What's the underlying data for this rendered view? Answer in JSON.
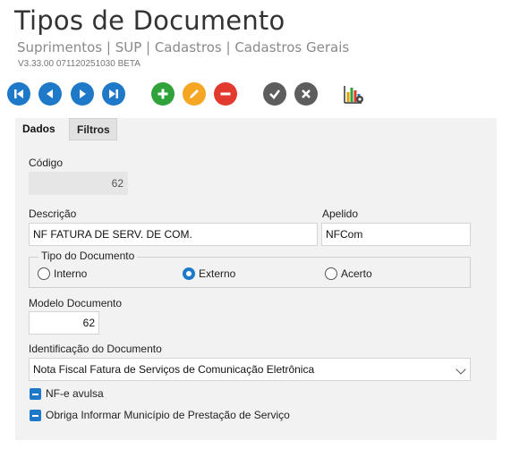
{
  "header": {
    "title": "Tipos de Documento",
    "breadcrumb": "Suprimentos | SUP | Cadastros | Cadastros Gerais",
    "version": "V3.33.00 071120251030 BETA"
  },
  "toolbar": {
    "icons": [
      "first-record-icon",
      "previous-record-icon",
      "next-record-icon",
      "last-record-icon",
      "add-icon",
      "edit-icon",
      "delete-icon",
      "confirm-icon",
      "cancel-icon",
      "chart-settings-icon"
    ],
    "colors": {
      "nav": "#1f79c9",
      "add": "#2fa33a",
      "edit": "#f5a623",
      "delete": "#e23a2e",
      "confirm": "#5d5d5d"
    }
  },
  "tabs": [
    "Dados",
    "Filtros"
  ],
  "form": {
    "codigo_label": "Código",
    "codigo_value": "62",
    "descricao_label": "Descrição",
    "descricao_value": "NF FATURA DE SERV. DE COM.",
    "apelido_label": "Apelido",
    "apelido_value": "NFCom",
    "tipo_legend": "Tipo do Documento",
    "tipo_options": [
      "Interno",
      "Externo",
      "Acerto"
    ],
    "tipo_selected": "Externo",
    "modelo_label": "Modelo Documento",
    "modelo_value": "62",
    "identificacao_label": "Identificação do Documento",
    "identificacao_value": "Nota Fiscal Fatura de Serviços de Comunicação Eletrônica",
    "check_nfe_avulsa": "NF-e avulsa",
    "check_municipio": "Obriga Informar Município de Prestação de Serviço"
  }
}
